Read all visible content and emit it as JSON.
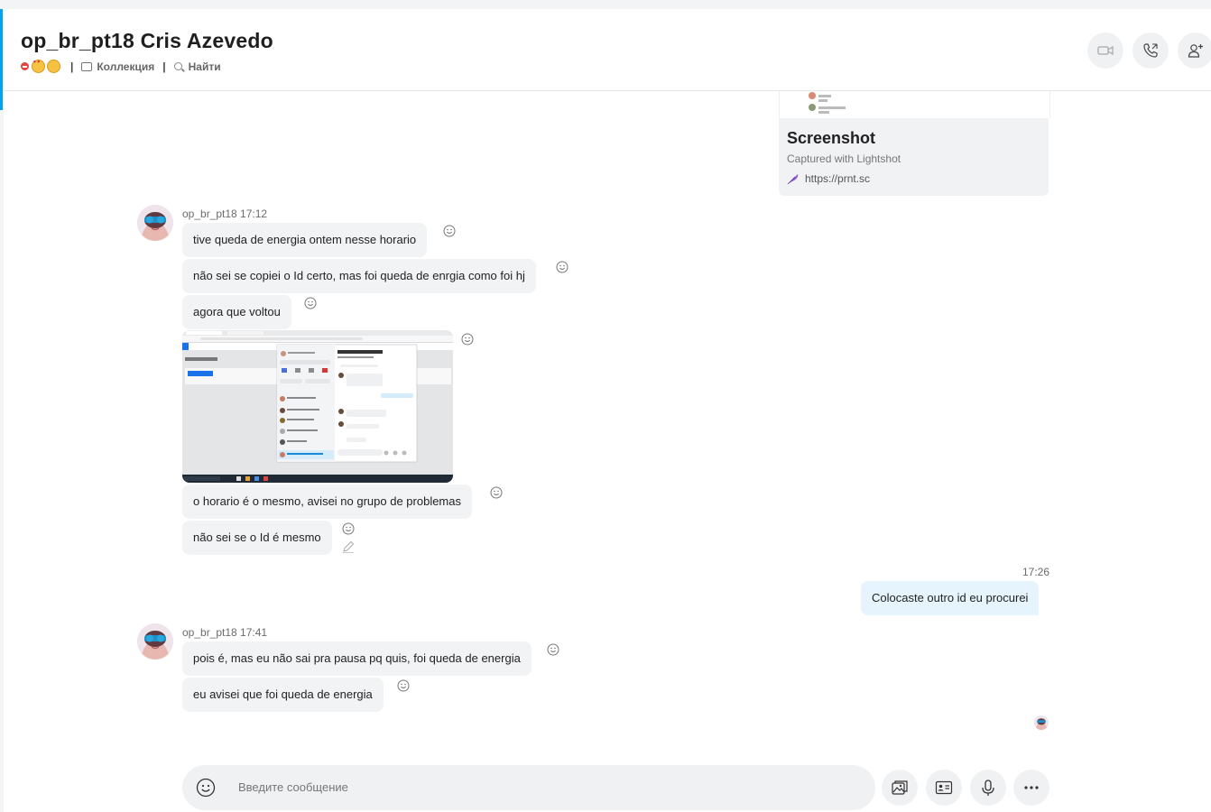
{
  "header": {
    "title": "op_br_pt18 Cris Azevedo",
    "gallery_label": "Коллекция",
    "search_label": "Найти",
    "separator": "|"
  },
  "link_preview": {
    "title": "Screenshot",
    "subtitle": "Captured with Lightshot",
    "url": "https://prnt.sc"
  },
  "messages": {
    "group1": {
      "sender_time": "op_br_pt18 17:12",
      "texts": [
        "tive queda de energia ontem nesse horario",
        "não sei se copiei o Id certo, mas foi queda de enrgia como foi hj",
        "agora que voltou",
        "o horario é o mesmo, avisei no grupo de problemas",
        "não sei se o Id é mesmo"
      ]
    },
    "outgoing": {
      "time": "17:26",
      "text": "Colocaste outro id eu procurei"
    },
    "group2": {
      "sender_time": "op_br_pt18 17:41",
      "texts": [
        "pois é, mas eu não sai pra pausa pq quis, foi queda de energia",
        "eu avisei que foi queda de energia"
      ]
    }
  },
  "composer": {
    "placeholder": "Введите сообщение"
  },
  "icons": {
    "video": "video-call-icon",
    "call": "phone-call-icon",
    "add_people": "add-people-icon",
    "emoji": "emoji-icon",
    "gallery": "media-gallery-icon",
    "contact": "contact-card-icon",
    "mic": "microphone-icon",
    "more": "more-options-icon"
  },
  "colors": {
    "accent": "#00a2ed",
    "incoming_bubble": "#f2f3f5",
    "outgoing_bubble": "#e6f4fd",
    "status_busy": "#e4443c"
  }
}
